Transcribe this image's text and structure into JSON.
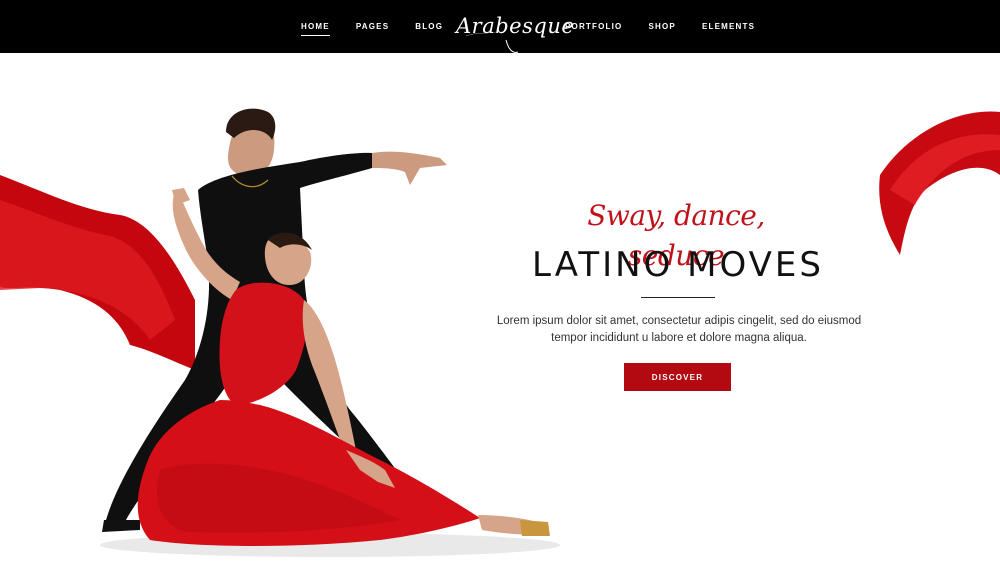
{
  "nav": {
    "items_left": [
      {
        "label": "HOME",
        "active": true
      },
      {
        "label": "PAGES"
      },
      {
        "label": "BLOG"
      }
    ],
    "items_right": [
      {
        "label": "PORTFOLIO"
      },
      {
        "label": "SHOP"
      },
      {
        "label": "ELEMENTS"
      }
    ]
  },
  "logo": {
    "text": "Arabesque"
  },
  "hero": {
    "tagline": "Sway, dance, seduce",
    "headline": "LATINO MOVES",
    "lead_line1": "Lorem ipsum dolor sit amet, consectetur adipis cingelit, sed do eiusmod",
    "lead_line2": "tempor incididunt u labore et dolore magna aliqua.",
    "cta_label": "DISCOVER"
  },
  "colors": {
    "topbar": "#000000",
    "accent_red": "#b30a11",
    "tagline_red": "#c0121b",
    "background": "#ffffff"
  }
}
